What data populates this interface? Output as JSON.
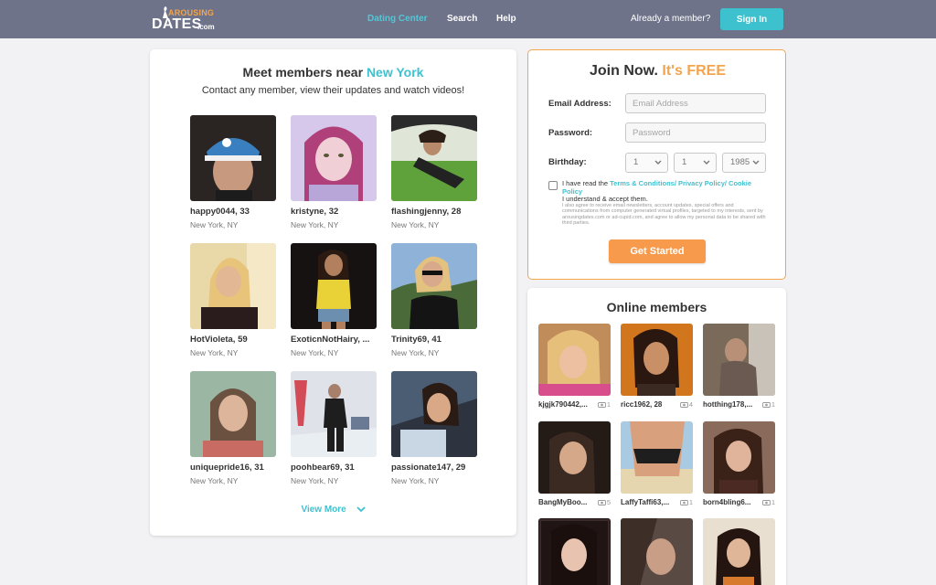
{
  "logo": {
    "line1": "AROUSING",
    "line2": "DATES",
    "suffix": ".com"
  },
  "nav": [
    {
      "label": "Dating Center",
      "active": true
    },
    {
      "label": "Search",
      "active": false
    },
    {
      "label": "Help",
      "active": false
    }
  ],
  "header": {
    "already_member": "Already a member?",
    "sign_in": "Sign In"
  },
  "members_panel": {
    "title_prefix": "Meet members near",
    "city": "New York",
    "subtitle": "Contact any member, view their updates and watch videos!",
    "members": [
      {
        "name": "happy0044, 33",
        "location": "New York, NY"
      },
      {
        "name": "kristyne, 32",
        "location": "New York, NY"
      },
      {
        "name": "flashingjenny, 28",
        "location": "New York, NY"
      },
      {
        "name": "HotVioleta, 59",
        "location": "New York, NY"
      },
      {
        "name": "ExoticnNotHairy, ...",
        "location": "New York, NY"
      },
      {
        "name": "Trinity69, 41",
        "location": "New York, NY"
      },
      {
        "name": "uniquepride16, 31",
        "location": "New York, NY"
      },
      {
        "name": "poohbear69, 31",
        "location": "New York, NY"
      },
      {
        "name": "passionate147, 29",
        "location": "New York, NY"
      }
    ],
    "view_more": "View More"
  },
  "join": {
    "title_prefix": "Join Now.",
    "title_free": "It's FREE",
    "email_label": "Email Address:",
    "email_placeholder": "Email Address",
    "password_label": "Password:",
    "password_placeholder": "Password",
    "birthday_label": "Birthday:",
    "birthday_month": "1",
    "birthday_day": "1",
    "birthday_year": "1985",
    "terms_prefix": "I have read the",
    "terms_link": "Terms & Conditions/ Privacy Policy/ Cookie Policy",
    "terms_suffix": "I understand & accept them.",
    "fine_print": "I also agree to receive email newsletters, account updates, special offers and communications from computer generated virtual profiles, targeted to my interests, sent by arousingdates.com or ad-cupid.com, and agree to allow my personal data to be shared with third parties.",
    "cta": "Get Started"
  },
  "online": {
    "title": "Online members",
    "members": [
      {
        "name": "kjgjk790442,...",
        "photos": "1"
      },
      {
        "name": "ricc1962, 28",
        "photos": "4"
      },
      {
        "name": "hotthing178,...",
        "photos": "1"
      },
      {
        "name": "BangMyBoo...",
        "photos": "5"
      },
      {
        "name": "LaffyTaffi63,...",
        "photos": "1"
      },
      {
        "name": "born4bling6...",
        "photos": "1"
      }
    ]
  },
  "colors": {
    "header_bg": "#6e7389",
    "accent_teal": "#3ec1cf",
    "accent_orange": "#f3a44d",
    "cta_orange": "#f79a4b"
  }
}
